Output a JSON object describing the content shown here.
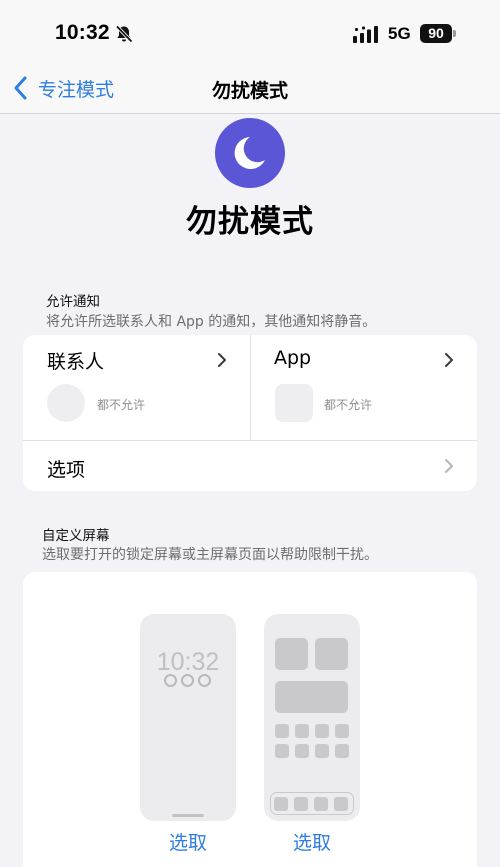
{
  "status_bar": {
    "time": "10:32",
    "network": "5G",
    "battery": "90",
    "icons": [
      "bell-slash-icon",
      "signal-icon",
      "battery-icon"
    ]
  },
  "nav": {
    "back_label": "专注模式",
    "title": "勿扰模式"
  },
  "hero": {
    "icon": "moon-icon",
    "icon_color": "#5b56d6",
    "title": "勿扰模式"
  },
  "allow_section": {
    "title": "允许通知",
    "description": "将允许所选联系人和 App 的通知，其他通知将静音。",
    "tiles": [
      {
        "label": "联系人",
        "status": "都不允许"
      },
      {
        "label": "App",
        "status": "都不允许"
      }
    ],
    "options_label": "选项"
  },
  "screen_section": {
    "title": "自定义屏幕",
    "description": "选取要打开的锁定屏幕或主屏幕页面以帮助限制干扰。",
    "lock_preview_time": "10:32",
    "choose_labels": [
      "选取",
      "选取"
    ]
  },
  "colors": {
    "accent": "#2f7de1",
    "background": "#f2f2f7"
  }
}
